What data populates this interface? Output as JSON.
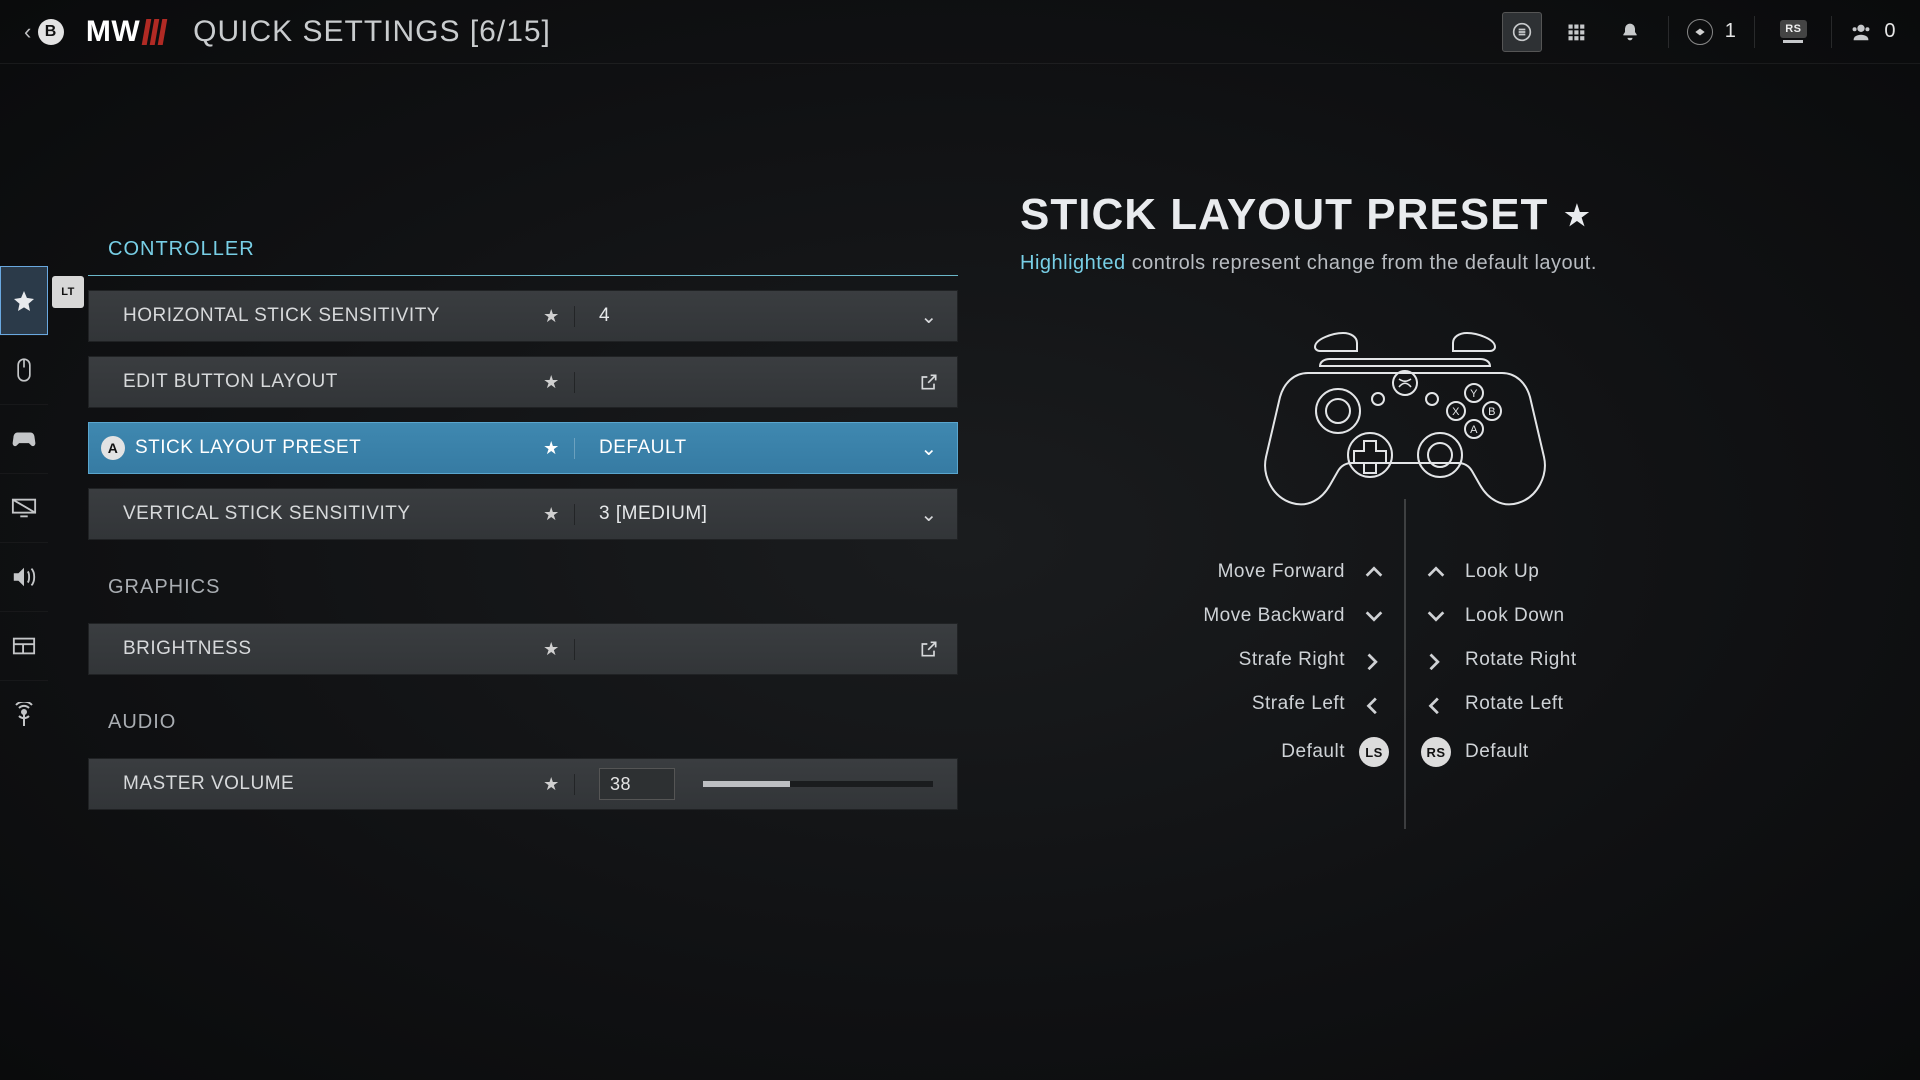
{
  "header": {
    "back_button": "B",
    "logo_prefix": "MW",
    "page_title": "QUICK SETTINGS [6/15]",
    "rank_count": "1",
    "rs_label": "RS",
    "party_count": "0"
  },
  "left_nav": {
    "lt_label": "LT"
  },
  "sections": {
    "controller": {
      "heading": "CONTROLLER",
      "rows": {
        "horiz_sens": {
          "label": "HORIZONTAL STICK SENSITIVITY",
          "value": "4"
        },
        "edit_layout": {
          "label": "EDIT BUTTON LAYOUT"
        },
        "stick_preset": {
          "label": "STICK LAYOUT PRESET",
          "a_prompt": "A",
          "value": "DEFAULT"
        },
        "vert_sens": {
          "label": "VERTICAL STICK SENSITIVITY",
          "value": "3 [MEDIUM]"
        }
      }
    },
    "graphics": {
      "heading": "GRAPHICS",
      "rows": {
        "brightness": {
          "label": "BRIGHTNESS"
        }
      }
    },
    "audio": {
      "heading": "AUDIO",
      "rows": {
        "master_volume": {
          "label": "MASTER VOLUME",
          "value": "38",
          "percent": 38
        }
      }
    }
  },
  "detail": {
    "title": "STICK LAYOUT PRESET",
    "sub_highlight": "Highlighted",
    "sub_rest": " controls represent change from the default layout.",
    "mapping": {
      "left": [
        {
          "label": "Move Forward",
          "dir": "up"
        },
        {
          "label": "Move Backward",
          "dir": "down"
        },
        {
          "label": "Strafe Right",
          "dir": "right"
        },
        {
          "label": "Strafe Left",
          "dir": "left"
        },
        {
          "label": "Default",
          "stick": "LS"
        }
      ],
      "right": [
        {
          "label": "Look Up",
          "dir": "up"
        },
        {
          "label": "Look Down",
          "dir": "down"
        },
        {
          "label": "Rotate Right",
          "dir": "right"
        },
        {
          "label": "Rotate Left",
          "dir": "left"
        },
        {
          "label": "Default",
          "stick": "RS"
        }
      ]
    }
  }
}
